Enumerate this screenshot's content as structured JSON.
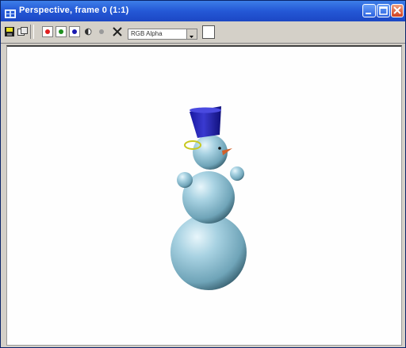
{
  "window": {
    "title": "Perspective, frame 0 (1:1)",
    "accent": "#2458d6"
  },
  "toolbar": {
    "tools": [
      {
        "icon": "save-icon"
      },
      {
        "icon": "clone-icon"
      },
      {
        "icon": "red-channel-icon",
        "color": "#e02020"
      },
      {
        "icon": "green-channel-icon",
        "color": "#209020"
      },
      {
        "icon": "blue-channel-icon",
        "color": "#1a1ab0"
      },
      {
        "icon": "alpha-channel-icon"
      },
      {
        "icon": "mono-channel-icon"
      },
      {
        "icon": "clear-icon"
      }
    ],
    "channel_select": {
      "value": "RGB Alpha"
    },
    "color_swatch": "#ffffff"
  },
  "viewport": {
    "scene": "snowman-render",
    "colors": {
      "body": "#9ec8dc",
      "hat": "#2a2ab0",
      "nose": "#d2602a",
      "halo": "#c8c820"
    }
  }
}
